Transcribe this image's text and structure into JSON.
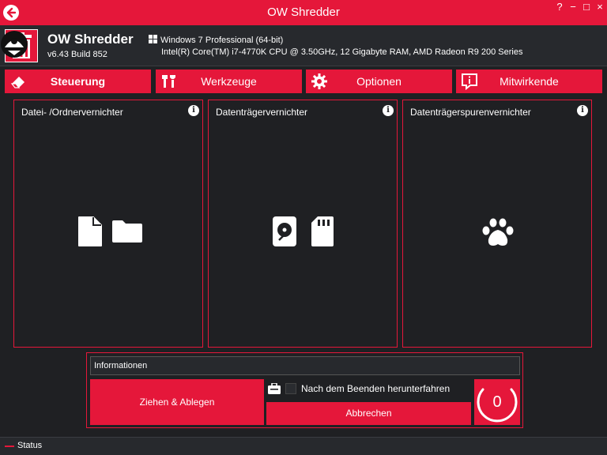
{
  "window": {
    "title": "OW Shredder",
    "help_glyph": "?",
    "minimize_glyph": "−",
    "maximize_glyph": "□",
    "close_glyph": "×"
  },
  "header": {
    "app_name": "OW Shredder",
    "version": "v6.43 Build 852",
    "os": "Windows 7 Professional  (64-bit)",
    "hardware": "Intel(R) Core(TM) i7-4770K CPU @ 3.50GHz, 12 Gigabyte RAM, AMD Radeon R9 200 Series"
  },
  "nav": {
    "tabs": [
      {
        "label": "Steuerung",
        "icon": "eraser-icon",
        "active": true
      },
      {
        "label": "Werkzeuge",
        "icon": "tools-icon",
        "active": false
      },
      {
        "label": "Optionen",
        "icon": "gear-icon",
        "active": false
      },
      {
        "label": "Mitwirkende",
        "icon": "info-icon",
        "active": false
      }
    ]
  },
  "panels": [
    {
      "title": "Datei- /Ordnervernichter",
      "icons": [
        "file-icon",
        "folder-icon"
      ]
    },
    {
      "title": "Datenträgervernichter",
      "icons": [
        "hard-drive-icon",
        "sd-card-icon"
      ]
    },
    {
      "title": "Datenträgerspurenvernichter",
      "icons": [
        "paw-icon"
      ]
    }
  ],
  "info_glyph": "i",
  "bottom": {
    "info_header": "Informationen",
    "drag_drop_label": "Ziehen & Ablegen",
    "shutdown_label": "Nach dem Beenden herunterfahren",
    "shutdown_checked": false,
    "cancel_label": "Abbrechen",
    "counter": "0"
  },
  "status": {
    "text": "Status"
  },
  "colors": {
    "accent": "#e5173a",
    "background": "#1f2023",
    "header_bg": "#27292d"
  }
}
